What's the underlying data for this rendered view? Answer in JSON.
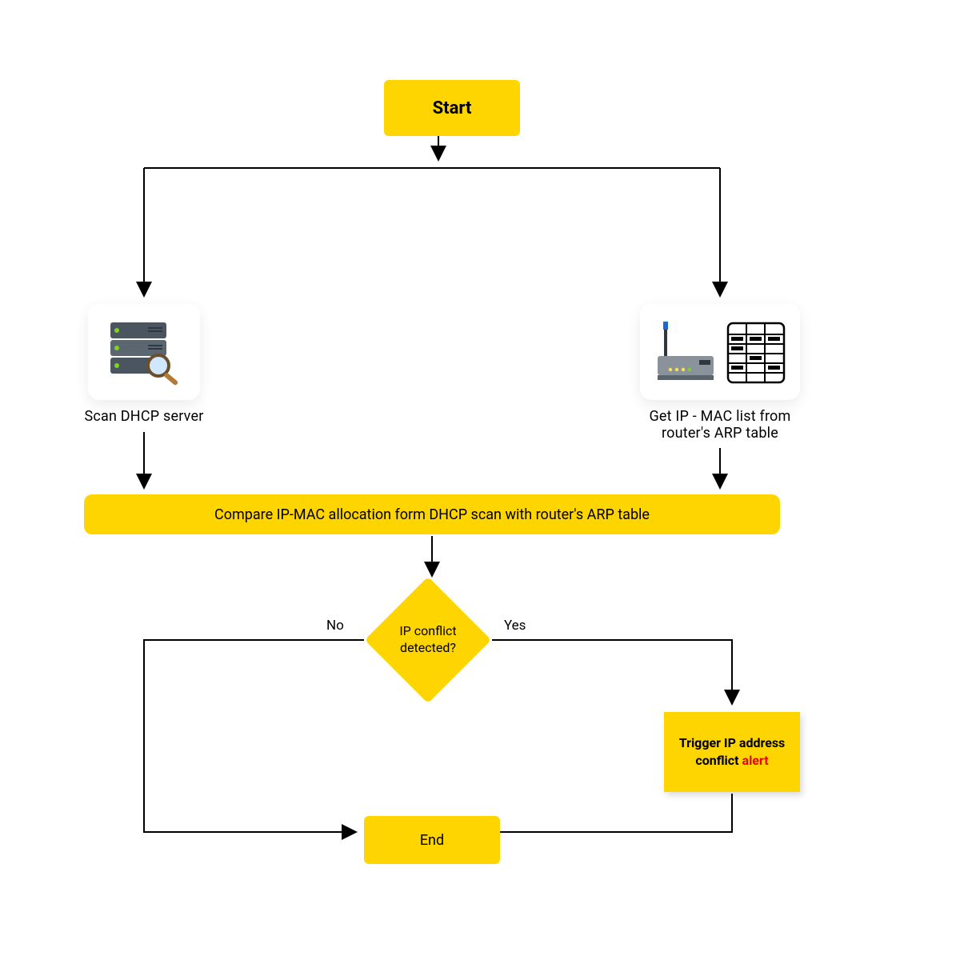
{
  "nodes": {
    "start": "Start",
    "scan_dhcp": "Scan DHCP server",
    "get_arp": "Get IP - MAC list from router's ARP table",
    "compare": "Compare IP-MAC allocation form DHCP scan with router's ARP table",
    "decision": "IP conflict detected?",
    "decision_no": "No",
    "decision_yes": "Yes",
    "trigger_line1": "Trigger IP address conflict",
    "trigger_alert": "alert",
    "end": "End"
  },
  "colors": {
    "accent": "#ffd500",
    "alert": "#e30613"
  }
}
